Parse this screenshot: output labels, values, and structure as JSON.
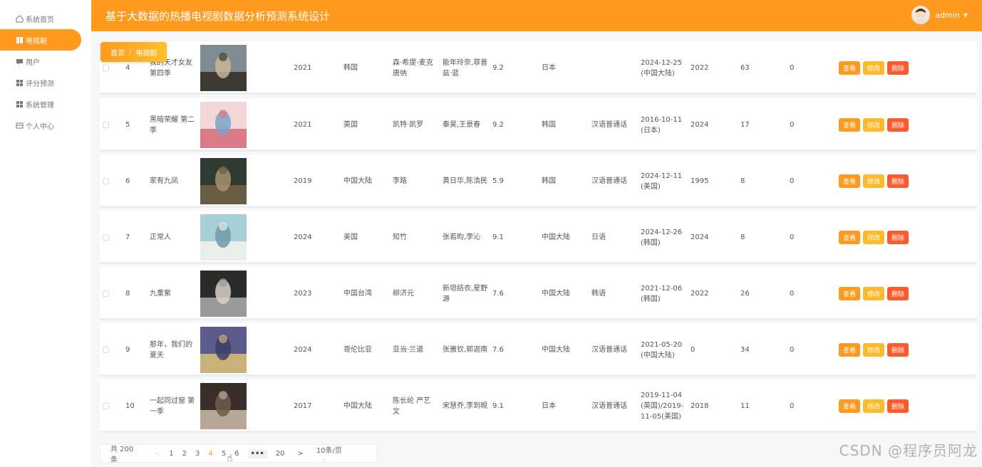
{
  "app": {
    "title": "基于大数据的热播电视剧数据分析预测系统设计",
    "user": "admin"
  },
  "sidebar": {
    "items": [
      {
        "label": "系统首页",
        "icon": "home-icon"
      },
      {
        "label": "电视剧",
        "icon": "book-icon"
      },
      {
        "label": "用户",
        "icon": "chat-icon"
      },
      {
        "label": "评分预测",
        "icon": "grid-icon"
      },
      {
        "label": "系统管理",
        "icon": "grid-icon"
      },
      {
        "label": "个人中心",
        "icon": "card-icon"
      }
    ]
  },
  "breadcrumb": {
    "home": "首页",
    "sep": "/",
    "current": "电视剧"
  },
  "buttons": {
    "view": "查看",
    "edit": "修改",
    "delete": "删除"
  },
  "rows": [
    {
      "no": "4",
      "name": "我的天才女友 第四季",
      "year": "2021",
      "country": "韩国",
      "director": "森·希提-麦克唐纳",
      "actors": "能年玲奈,菲普兹·蓝",
      "rating": "9.2",
      "region": "日本",
      "language": "",
      "release": "2024-12-25 (中国大陆)",
      "year2": "2022",
      "count": "63",
      "zero": "0",
      "poster": [
        "#7f8b93",
        "#3c3a33",
        "#c9b595"
      ]
    },
    {
      "no": "5",
      "name": "黑暗荣耀 第二季",
      "year": "2021",
      "country": "英国",
      "director": "凯特·凯罗",
      "actors": "秦昊,王景春",
      "rating": "9.2",
      "region": "韩国",
      "language": "汉语普通话",
      "release": "2016-10-11 (日本)",
      "year2": "2024",
      "count": "17",
      "zero": "0",
      "poster": [
        "#f3d6d8",
        "#d97b86",
        "#7aa5c9"
      ]
    },
    {
      "no": "6",
      "name": "家有九凤",
      "year": "2019",
      "country": "中国大陆",
      "director": "李路",
      "actors": "黄日华,陈浩民",
      "rating": "5.9",
      "region": "韩国",
      "language": "汉语普通话",
      "release": "2024-12-11 (美国)",
      "year2": "1995",
      "count": "8",
      "zero": "0",
      "poster": [
        "#2f3a33",
        "#6b5b43",
        "#a8936b"
      ]
    },
    {
      "no": "7",
      "name": "正常人",
      "year": "2024",
      "country": "美国",
      "director": "知竹",
      "actors": "张若昀,李沁",
      "rating": "9.1",
      "region": "中国大陆",
      "language": "日语",
      "release": "2024-12-26 (韩国)",
      "year2": "2024",
      "count": "8",
      "zero": "0",
      "poster": [
        "#a9cfd9",
        "#e7efe8",
        "#6f9aa8"
      ]
    },
    {
      "no": "8",
      "name": "九重紫",
      "year": "2023",
      "country": "中国台湾",
      "director": "柳济元",
      "actors": "新垣结衣,星野源",
      "rating": "7.6",
      "region": "中国大陆",
      "language": "韩语",
      "release": "2021-12-06 (韩国)",
      "year2": "2022",
      "count": "26",
      "zero": "0",
      "poster": [
        "#2b2b2b",
        "#9a9a9a",
        "#d9d2c4"
      ]
    },
    {
      "no": "9",
      "name": "那年，我们的夏天",
      "year": "2024",
      "country": "哥伦比亚",
      "director": "亚当·兰道",
      "actors": "张雅钦,郭迦南",
      "rating": "7.6",
      "region": "中国大陆",
      "language": "汉语普通话",
      "release": "2021-05-20 (中国大陆)",
      "year2": "0",
      "count": "34",
      "zero": "0",
      "poster": [
        "#5d5a8c",
        "#c9b27a",
        "#3b3f66"
      ]
    },
    {
      "no": "10",
      "name": "一起同过窗 第一季",
      "year": "2017",
      "country": "中国大陆",
      "director": "陈长纶 严艺文",
      "actors": "宋慧乔,李到晛",
      "rating": "9.1",
      "region": "日本",
      "language": "汉语普通话",
      "release": "2019-11-04 (英国)/2019-11-05(美国)",
      "year2": "2018",
      "count": "11",
      "zero": "0",
      "poster": [
        "#3a2e2a",
        "#b9a795",
        "#6d5c4f"
      ]
    }
  ],
  "pagination": {
    "total": "共 200 条",
    "prev": "<",
    "pages": [
      "1",
      "2",
      "3",
      "4",
      "5",
      "6"
    ],
    "current": "4",
    "more": "•••",
    "last": "20",
    "next": ">",
    "size": "10条/页"
  },
  "watermark": "CSDN @程序员阿龙"
}
